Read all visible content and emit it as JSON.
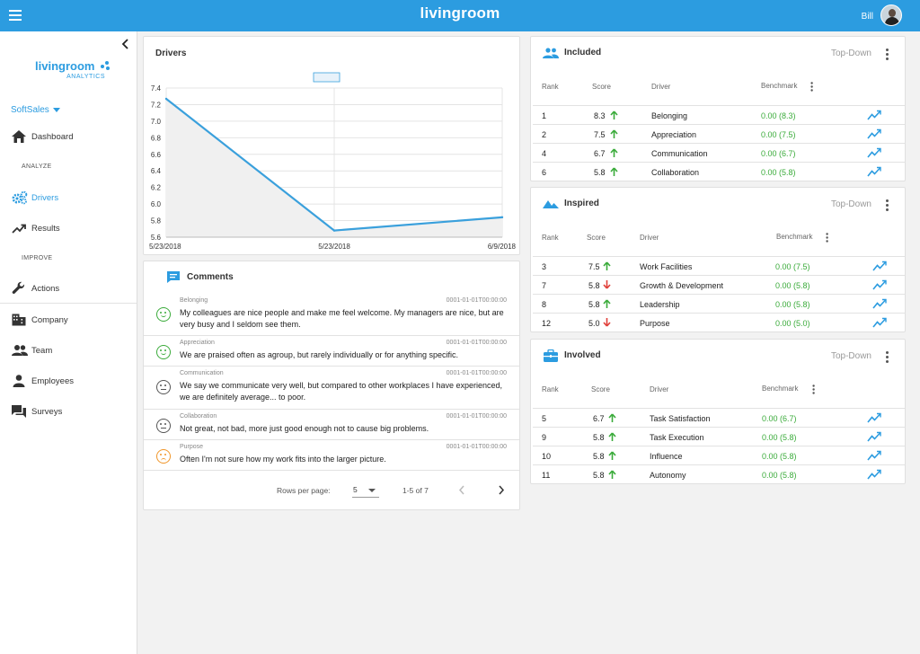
{
  "app": {
    "brand": "livingroom",
    "user_name": "Bill"
  },
  "sidebar": {
    "logo_main": "livingroom",
    "logo_sub": "ANALYTICS",
    "company": "SoftSales",
    "sections": {
      "analyze": "ANALYZE",
      "improve": "IMPROVE"
    },
    "items": [
      {
        "label": "Dashboard",
        "icon": "home-icon"
      },
      {
        "label": "Drivers",
        "icon": "gears-icon",
        "active": true
      },
      {
        "label": "Results",
        "icon": "trending-up-icon"
      },
      {
        "label": "Actions",
        "icon": "wrench-icon"
      },
      {
        "label": "Company",
        "icon": "building-icon"
      },
      {
        "label": "Team",
        "icon": "people-icon"
      },
      {
        "label": "Employees",
        "icon": "person-icon"
      },
      {
        "label": "Surveys",
        "icon": "chat-icon"
      }
    ]
  },
  "drivers_chart": {
    "title": "Drivers",
    "chart_data": {
      "type": "area",
      "x": [
        "5/23/2018",
        "5/23/2018",
        "6/9/2018"
      ],
      "series": [
        {
          "values": [
            7.27,
            5.68,
            5.84
          ]
        }
      ],
      "y_ticks": [
        "7.4",
        "7.2",
        "7.0",
        "6.8",
        "6.6",
        "6.4",
        "6.2",
        "6.0",
        "5.8",
        "5.6"
      ],
      "ylim": [
        5.6,
        7.4
      ],
      "grid": true,
      "line_color": "#3aa0dc",
      "fill_color": "#f0f0f0"
    }
  },
  "comments": {
    "title": "Comments",
    "items": [
      {
        "category": "Belonging",
        "timestamp": "0001-01-01T00:00:00",
        "text": "My colleagues are nice people and make me feel welcome. My managers are nice, but are very busy and I seldom see them.",
        "sentiment": "happy"
      },
      {
        "category": "Appreciation",
        "timestamp": "0001-01-01T00:00:00",
        "text": "We are praised often as agroup, but rarely individually or for anything specific.",
        "sentiment": "happy"
      },
      {
        "category": "Communication",
        "timestamp": "0001-01-01T00:00:00",
        "text": "We say we communicate very well, but compared to other workplaces I have experienced, we are definitely average... to poor.",
        "sentiment": "neutral"
      },
      {
        "category": "Collaboration",
        "timestamp": "0001-01-01T00:00:00",
        "text": "Not great, not bad, more just good enough not to cause big problems.",
        "sentiment": "neutral"
      },
      {
        "category": "Purpose",
        "timestamp": "0001-01-01T00:00:00",
        "text": "Often I'm not sure how my work fits into the larger picture.",
        "sentiment": "sad"
      }
    ],
    "pager": {
      "rows_label": "Rows per page:",
      "rows_value": "5",
      "range": "1-5 of 7"
    }
  },
  "tables": [
    {
      "title": "Included",
      "mode": "Top-Down",
      "icon": "people-icon",
      "headers": {
        "rank": "Rank",
        "score": "Score",
        "driver": "Driver",
        "benchmark": "Benchmark"
      },
      "rows": [
        {
          "rank": "1",
          "score": "8.3",
          "dir": "up",
          "driver": "Belonging",
          "benchmark": "0.00 (8.3)"
        },
        {
          "rank": "2",
          "score": "7.5",
          "dir": "up",
          "driver": "Appreciation",
          "benchmark": "0.00 (7.5)"
        },
        {
          "rank": "4",
          "score": "6.7",
          "dir": "up",
          "driver": "Communication",
          "benchmark": "0.00 (6.7)"
        },
        {
          "rank": "6",
          "score": "5.8",
          "dir": "up",
          "driver": "Collaboration",
          "benchmark": "0.00 (5.8)"
        }
      ]
    },
    {
      "title": "Inspired",
      "mode": "Top-Down",
      "icon": "mountain-icon",
      "headers": {
        "rank": "Rank",
        "score": "Score",
        "driver": "Driver",
        "benchmark": "Benchmark"
      },
      "rows": [
        {
          "rank": "3",
          "score": "7.5",
          "dir": "up",
          "driver": "Work Facilities",
          "benchmark": "0.00 (7.5)"
        },
        {
          "rank": "7",
          "score": "5.8",
          "dir": "down",
          "driver": "Growth & Development",
          "benchmark": "0.00 (5.8)"
        },
        {
          "rank": "8",
          "score": "5.8",
          "dir": "up",
          "driver": "Leadership",
          "benchmark": "0.00 (5.8)"
        },
        {
          "rank": "12",
          "score": "5.0",
          "dir": "down",
          "driver": "Purpose",
          "benchmark": "0.00 (5.0)"
        }
      ]
    },
    {
      "title": "Involved",
      "mode": "Top-Down",
      "icon": "briefcase-icon",
      "headers": {
        "rank": "Rank",
        "score": "Score",
        "driver": "Driver",
        "benchmark": "Benchmark"
      },
      "rows": [
        {
          "rank": "5",
          "score": "6.7",
          "dir": "up",
          "driver": "Task Satisfaction",
          "benchmark": "0.00 (6.7)"
        },
        {
          "rank": "9",
          "score": "5.8",
          "dir": "up",
          "driver": "Task Execution",
          "benchmark": "0.00 (5.8)"
        },
        {
          "rank": "10",
          "score": "5.8",
          "dir": "up",
          "driver": "Influence",
          "benchmark": "0.00 (5.8)"
        },
        {
          "rank": "11",
          "score": "5.8",
          "dir": "up",
          "driver": "Autonomy",
          "benchmark": "0.00 (5.8)"
        }
      ]
    }
  ],
  "colors": {
    "accent": "#2c9ce0",
    "up": "#3aab3a",
    "down": "#e0403a",
    "happy": "#3aab3a",
    "neutral": "#555555",
    "sad": "#f0962a"
  }
}
